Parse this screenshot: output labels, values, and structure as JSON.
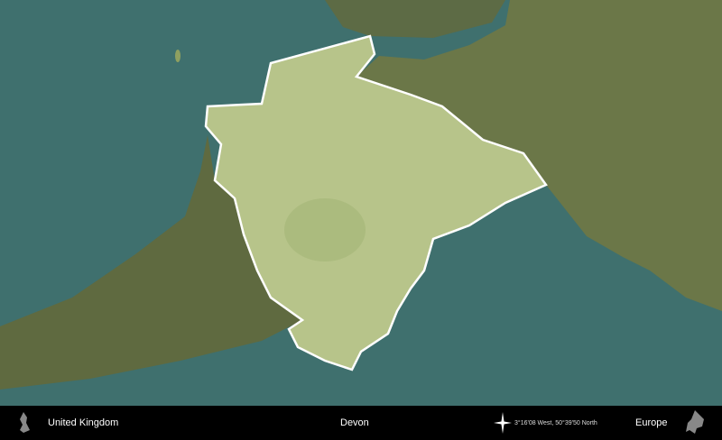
{
  "footer": {
    "country": "United Kingdom",
    "region": "Devon",
    "coordinates": "3°16'08 West, 50°39'50 North",
    "continent": "Europe"
  },
  "colors": {
    "sea": "#3f706e",
    "land": "#6b7a4a",
    "region": "#b7c48a",
    "outline": "#ffffff"
  },
  "icons": [
    "uk-silhouette-icon",
    "compass-rose-icon",
    "europe-silhouette-icon"
  ]
}
